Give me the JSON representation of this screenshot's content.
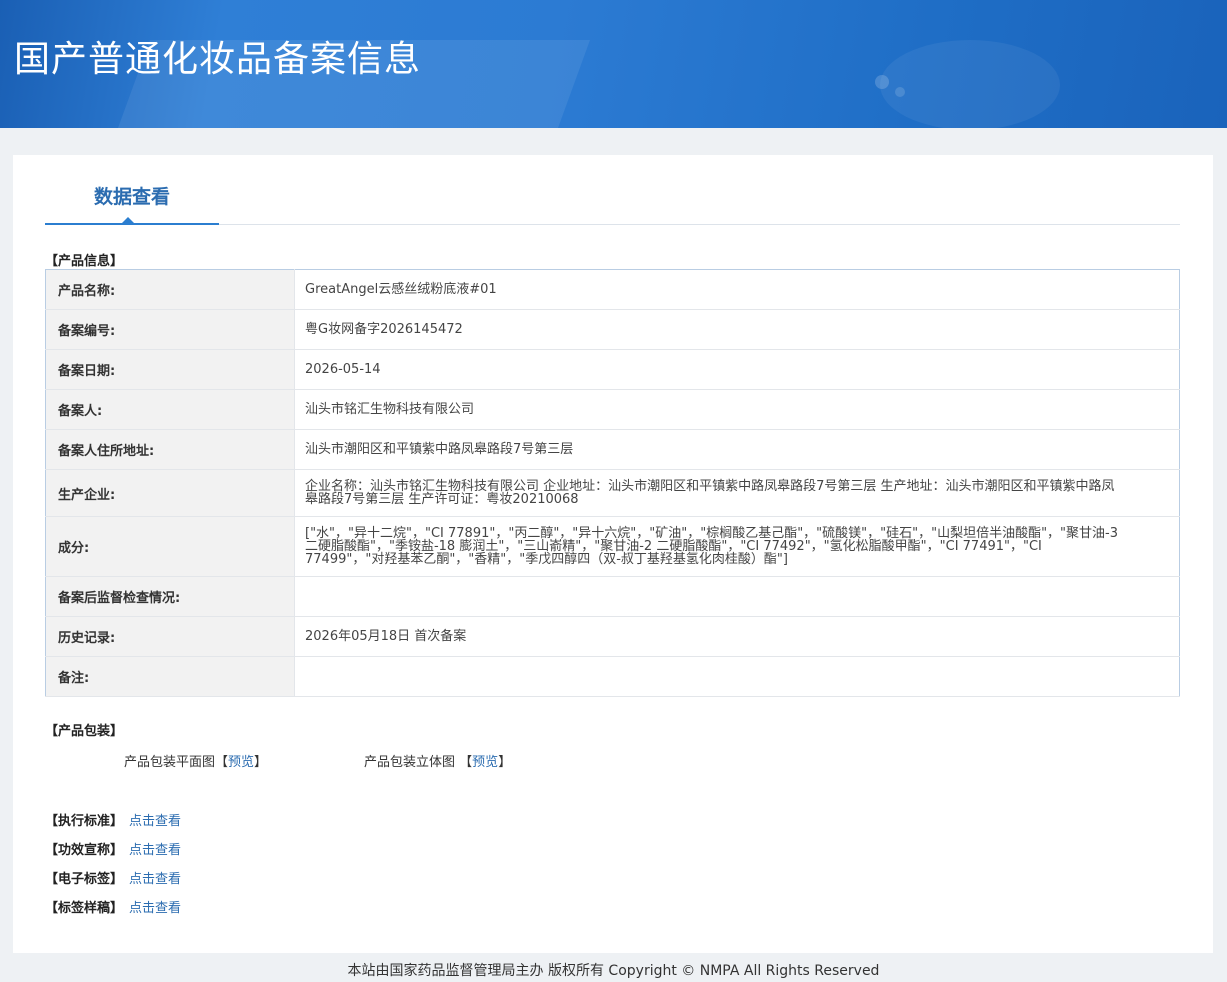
{
  "header": {
    "title": "国产普通化妆品备案信息"
  },
  "tab": {
    "label": "数据查看"
  },
  "product_info": {
    "section_title": "【产品信息】",
    "rows": [
      {
        "key": "产品名称:",
        "value": "GreatAngel云感丝绒粉底液#01"
      },
      {
        "key": "备案编号:",
        "value": "粤G妆网备字2026145472"
      },
      {
        "key": "备案日期:",
        "value": "2026-05-14"
      },
      {
        "key": "备案人:",
        "value": "汕头市铭汇生物科技有限公司"
      },
      {
        "key": "备案人住所地址:",
        "value": "汕头市潮阳区和平镇紫中路凤皋路段7号第三层"
      },
      {
        "key": "生产企业:",
        "value": "企业名称：汕头市铭汇生物科技有限公司 企业地址：汕头市潮阳区和平镇紫中路凤皋路段7号第三层 生产地址：汕头市潮阳区和平镇紫中路凤皋路段7号第三层 生产许可证：粤妆20210068"
      },
      {
        "key": "成分:",
        "value": "[\"水\"，\"异十二烷\"，\"CI 77891\"，\"丙二醇\"，\"异十六烷\"，\"矿油\"，\"棕榈酸乙基己酯\"，\"硫酸镁\"，\"硅石\"，\"山梨坦倍半油酸酯\"，\"聚甘油-3二硬脂酸酯\"，\"季铵盐-18 膨润土\"，\"三山嵛精\"，\"聚甘油-2 二硬脂酸酯\"，\"CI 77492\"，\"氢化松脂酸甲酯\"，\"CI 77491\"，\"CI 77499\"，\"对羟基苯乙酮\"，\"香精\"，\"季戊四醇四（双-叔丁基羟基氢化肉桂酸）酯\"]"
      },
      {
        "key": "备案后监督检查情况:",
        "value": ""
      },
      {
        "key": "历史记录:",
        "value": "2026年05月18日 首次备案"
      },
      {
        "key": "备注:",
        "value": ""
      }
    ]
  },
  "packaging": {
    "section_title": "【产品包装】",
    "flat_label": "产品包装平面图",
    "solid_label": "产品包装立体图",
    "bracket_open": "【",
    "bracket_close": "】",
    "preview": "预览"
  },
  "links": [
    {
      "label": "【执行标准】",
      "action": "点击查看"
    },
    {
      "label": "【功效宣称】",
      "action": "点击查看"
    },
    {
      "label": "【电子标签】",
      "action": "点击查看"
    },
    {
      "label": "【标签样稿】",
      "action": "点击查看"
    }
  ],
  "footer": {
    "text": "本站由国家药品监督管理局主办 版权所有 Copyright © NMPA All Rights Reserved"
  },
  "colors": {
    "header": "#2c7bd3",
    "accent": "#2b6cb0",
    "label_bg": "#f2f2f2",
    "table_border": "#b9cde3"
  }
}
